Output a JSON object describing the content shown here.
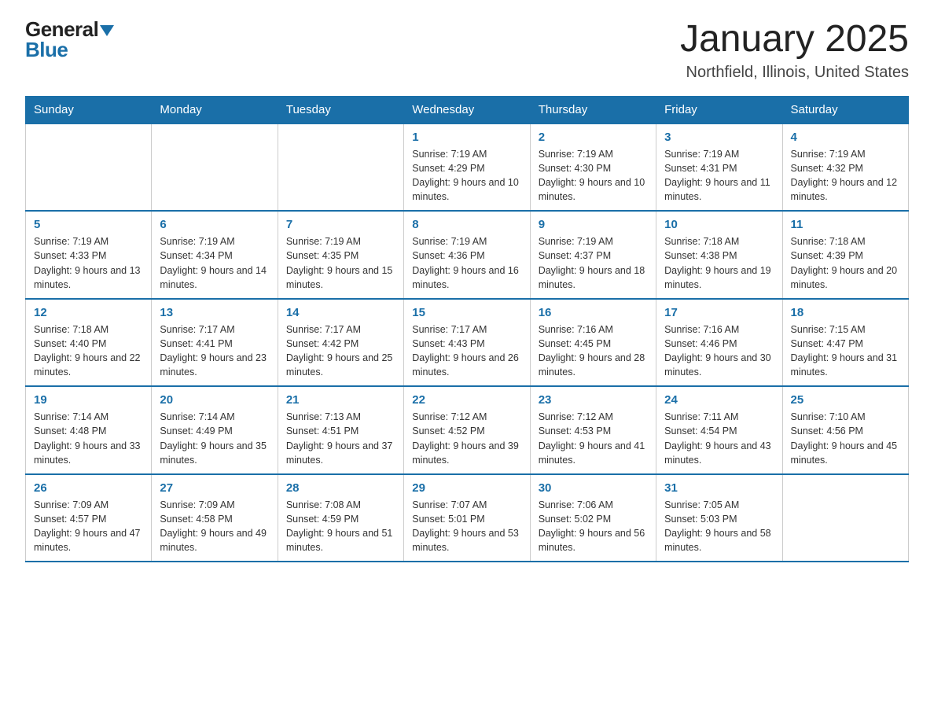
{
  "logo": {
    "general": "General",
    "blue": "Blue"
  },
  "title": "January 2025",
  "subtitle": "Northfield, Illinois, United States",
  "days_of_week": [
    "Sunday",
    "Monday",
    "Tuesday",
    "Wednesday",
    "Thursday",
    "Friday",
    "Saturday"
  ],
  "weeks": [
    [
      {
        "day": null
      },
      {
        "day": null
      },
      {
        "day": null
      },
      {
        "day": "1",
        "sunrise": "Sunrise: 7:19 AM",
        "sunset": "Sunset: 4:29 PM",
        "daylight": "Daylight: 9 hours and 10 minutes."
      },
      {
        "day": "2",
        "sunrise": "Sunrise: 7:19 AM",
        "sunset": "Sunset: 4:30 PM",
        "daylight": "Daylight: 9 hours and 10 minutes."
      },
      {
        "day": "3",
        "sunrise": "Sunrise: 7:19 AM",
        "sunset": "Sunset: 4:31 PM",
        "daylight": "Daylight: 9 hours and 11 minutes."
      },
      {
        "day": "4",
        "sunrise": "Sunrise: 7:19 AM",
        "sunset": "Sunset: 4:32 PM",
        "daylight": "Daylight: 9 hours and 12 minutes."
      }
    ],
    [
      {
        "day": "5",
        "sunrise": "Sunrise: 7:19 AM",
        "sunset": "Sunset: 4:33 PM",
        "daylight": "Daylight: 9 hours and 13 minutes."
      },
      {
        "day": "6",
        "sunrise": "Sunrise: 7:19 AM",
        "sunset": "Sunset: 4:34 PM",
        "daylight": "Daylight: 9 hours and 14 minutes."
      },
      {
        "day": "7",
        "sunrise": "Sunrise: 7:19 AM",
        "sunset": "Sunset: 4:35 PM",
        "daylight": "Daylight: 9 hours and 15 minutes."
      },
      {
        "day": "8",
        "sunrise": "Sunrise: 7:19 AM",
        "sunset": "Sunset: 4:36 PM",
        "daylight": "Daylight: 9 hours and 16 minutes."
      },
      {
        "day": "9",
        "sunrise": "Sunrise: 7:19 AM",
        "sunset": "Sunset: 4:37 PM",
        "daylight": "Daylight: 9 hours and 18 minutes."
      },
      {
        "day": "10",
        "sunrise": "Sunrise: 7:18 AM",
        "sunset": "Sunset: 4:38 PM",
        "daylight": "Daylight: 9 hours and 19 minutes."
      },
      {
        "day": "11",
        "sunrise": "Sunrise: 7:18 AM",
        "sunset": "Sunset: 4:39 PM",
        "daylight": "Daylight: 9 hours and 20 minutes."
      }
    ],
    [
      {
        "day": "12",
        "sunrise": "Sunrise: 7:18 AM",
        "sunset": "Sunset: 4:40 PM",
        "daylight": "Daylight: 9 hours and 22 minutes."
      },
      {
        "day": "13",
        "sunrise": "Sunrise: 7:17 AM",
        "sunset": "Sunset: 4:41 PM",
        "daylight": "Daylight: 9 hours and 23 minutes."
      },
      {
        "day": "14",
        "sunrise": "Sunrise: 7:17 AM",
        "sunset": "Sunset: 4:42 PM",
        "daylight": "Daylight: 9 hours and 25 minutes."
      },
      {
        "day": "15",
        "sunrise": "Sunrise: 7:17 AM",
        "sunset": "Sunset: 4:43 PM",
        "daylight": "Daylight: 9 hours and 26 minutes."
      },
      {
        "day": "16",
        "sunrise": "Sunrise: 7:16 AM",
        "sunset": "Sunset: 4:45 PM",
        "daylight": "Daylight: 9 hours and 28 minutes."
      },
      {
        "day": "17",
        "sunrise": "Sunrise: 7:16 AM",
        "sunset": "Sunset: 4:46 PM",
        "daylight": "Daylight: 9 hours and 30 minutes."
      },
      {
        "day": "18",
        "sunrise": "Sunrise: 7:15 AM",
        "sunset": "Sunset: 4:47 PM",
        "daylight": "Daylight: 9 hours and 31 minutes."
      }
    ],
    [
      {
        "day": "19",
        "sunrise": "Sunrise: 7:14 AM",
        "sunset": "Sunset: 4:48 PM",
        "daylight": "Daylight: 9 hours and 33 minutes."
      },
      {
        "day": "20",
        "sunrise": "Sunrise: 7:14 AM",
        "sunset": "Sunset: 4:49 PM",
        "daylight": "Daylight: 9 hours and 35 minutes."
      },
      {
        "day": "21",
        "sunrise": "Sunrise: 7:13 AM",
        "sunset": "Sunset: 4:51 PM",
        "daylight": "Daylight: 9 hours and 37 minutes."
      },
      {
        "day": "22",
        "sunrise": "Sunrise: 7:12 AM",
        "sunset": "Sunset: 4:52 PM",
        "daylight": "Daylight: 9 hours and 39 minutes."
      },
      {
        "day": "23",
        "sunrise": "Sunrise: 7:12 AM",
        "sunset": "Sunset: 4:53 PM",
        "daylight": "Daylight: 9 hours and 41 minutes."
      },
      {
        "day": "24",
        "sunrise": "Sunrise: 7:11 AM",
        "sunset": "Sunset: 4:54 PM",
        "daylight": "Daylight: 9 hours and 43 minutes."
      },
      {
        "day": "25",
        "sunrise": "Sunrise: 7:10 AM",
        "sunset": "Sunset: 4:56 PM",
        "daylight": "Daylight: 9 hours and 45 minutes."
      }
    ],
    [
      {
        "day": "26",
        "sunrise": "Sunrise: 7:09 AM",
        "sunset": "Sunset: 4:57 PM",
        "daylight": "Daylight: 9 hours and 47 minutes."
      },
      {
        "day": "27",
        "sunrise": "Sunrise: 7:09 AM",
        "sunset": "Sunset: 4:58 PM",
        "daylight": "Daylight: 9 hours and 49 minutes."
      },
      {
        "day": "28",
        "sunrise": "Sunrise: 7:08 AM",
        "sunset": "Sunset: 4:59 PM",
        "daylight": "Daylight: 9 hours and 51 minutes."
      },
      {
        "day": "29",
        "sunrise": "Sunrise: 7:07 AM",
        "sunset": "Sunset: 5:01 PM",
        "daylight": "Daylight: 9 hours and 53 minutes."
      },
      {
        "day": "30",
        "sunrise": "Sunrise: 7:06 AM",
        "sunset": "Sunset: 5:02 PM",
        "daylight": "Daylight: 9 hours and 56 minutes."
      },
      {
        "day": "31",
        "sunrise": "Sunrise: 7:05 AM",
        "sunset": "Sunset: 5:03 PM",
        "daylight": "Daylight: 9 hours and 58 minutes."
      },
      {
        "day": null
      }
    ]
  ]
}
